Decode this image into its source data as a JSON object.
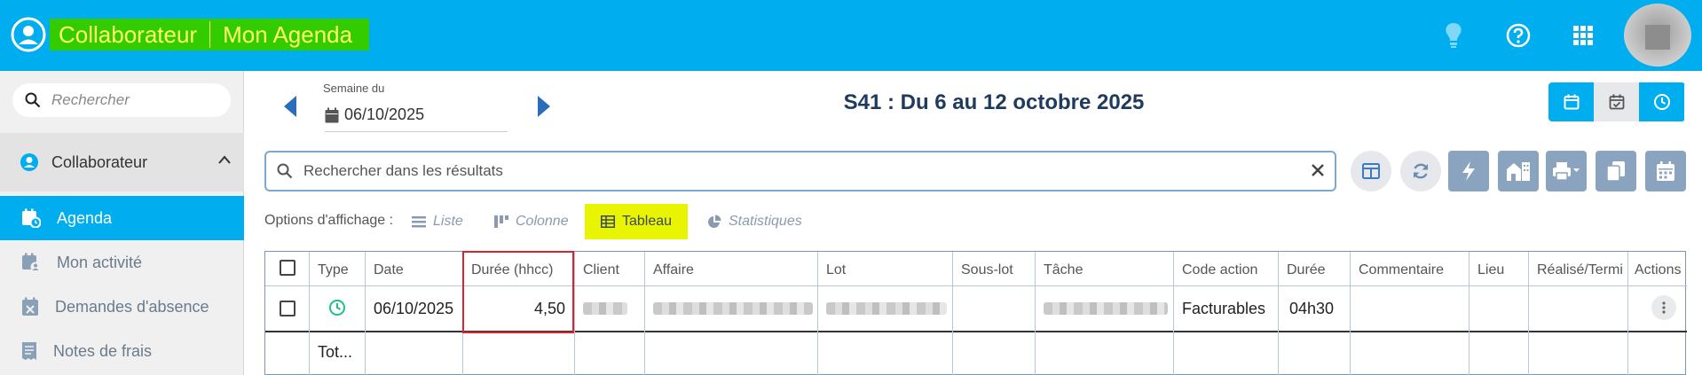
{
  "header": {
    "module": "Collaborateur",
    "section": "Mon Agenda",
    "brand_bg": "#00aeef",
    "title_bg": "#33cc00",
    "title_color": "#ffff66",
    "icons": [
      "lightbulb-icon",
      "help-icon",
      "apps-grid-icon"
    ]
  },
  "sidebar": {
    "search_placeholder": "Rechercher",
    "group": {
      "label": "Collaborateur",
      "expanded": true
    },
    "items": [
      {
        "label": "Agenda",
        "icon": "calendar-clock-icon",
        "active": true
      },
      {
        "label": "Mon activité",
        "icon": "calendar-user-icon",
        "active": false
      },
      {
        "label": "Demandes d'absence",
        "icon": "calendar-x-icon",
        "active": false
      },
      {
        "label": "Notes de frais",
        "icon": "receipt-icon",
        "active": false
      }
    ]
  },
  "week": {
    "label": "Semaine du",
    "date": "06/10/2025",
    "title": "S41 : Du 6 au 12 octobre 2025"
  },
  "view_buttons": [
    "calendar-icon",
    "calendar-check-icon",
    "clock-icon"
  ],
  "results": {
    "search_placeholder": "Rechercher dans les résultats"
  },
  "toolbar": [
    "columns-icon",
    "refresh-icon",
    "bolt-icon",
    "building-icon",
    "print-icon",
    "copy-icon",
    "calendar-grid-icon"
  ],
  "display_options": {
    "label": "Options d'affichage :",
    "options": [
      {
        "label": "Liste",
        "icon": "list-icon",
        "selected": false
      },
      {
        "label": "Colonne",
        "icon": "columns-icon",
        "selected": false
      },
      {
        "label": "Tableau",
        "icon": "table-icon",
        "selected": true
      },
      {
        "label": "Statistiques",
        "icon": "pie-chart-icon",
        "selected": false
      }
    ]
  },
  "table": {
    "headers": [
      "Type",
      "Date",
      "Durée (hhcc)",
      "Client",
      "Affaire",
      "Lot",
      "Sous-lot",
      "Tâche",
      "Code action",
      "Durée",
      "Commentaire",
      "Lieu",
      "Réalisé/Terminé",
      "Actions"
    ],
    "row": {
      "type_icon": "clock-icon",
      "date": "06/10/2025",
      "duree_hhcc": "4,50",
      "code_action": "Facturables",
      "duree": "04h30"
    },
    "total_label": "Tot..."
  }
}
